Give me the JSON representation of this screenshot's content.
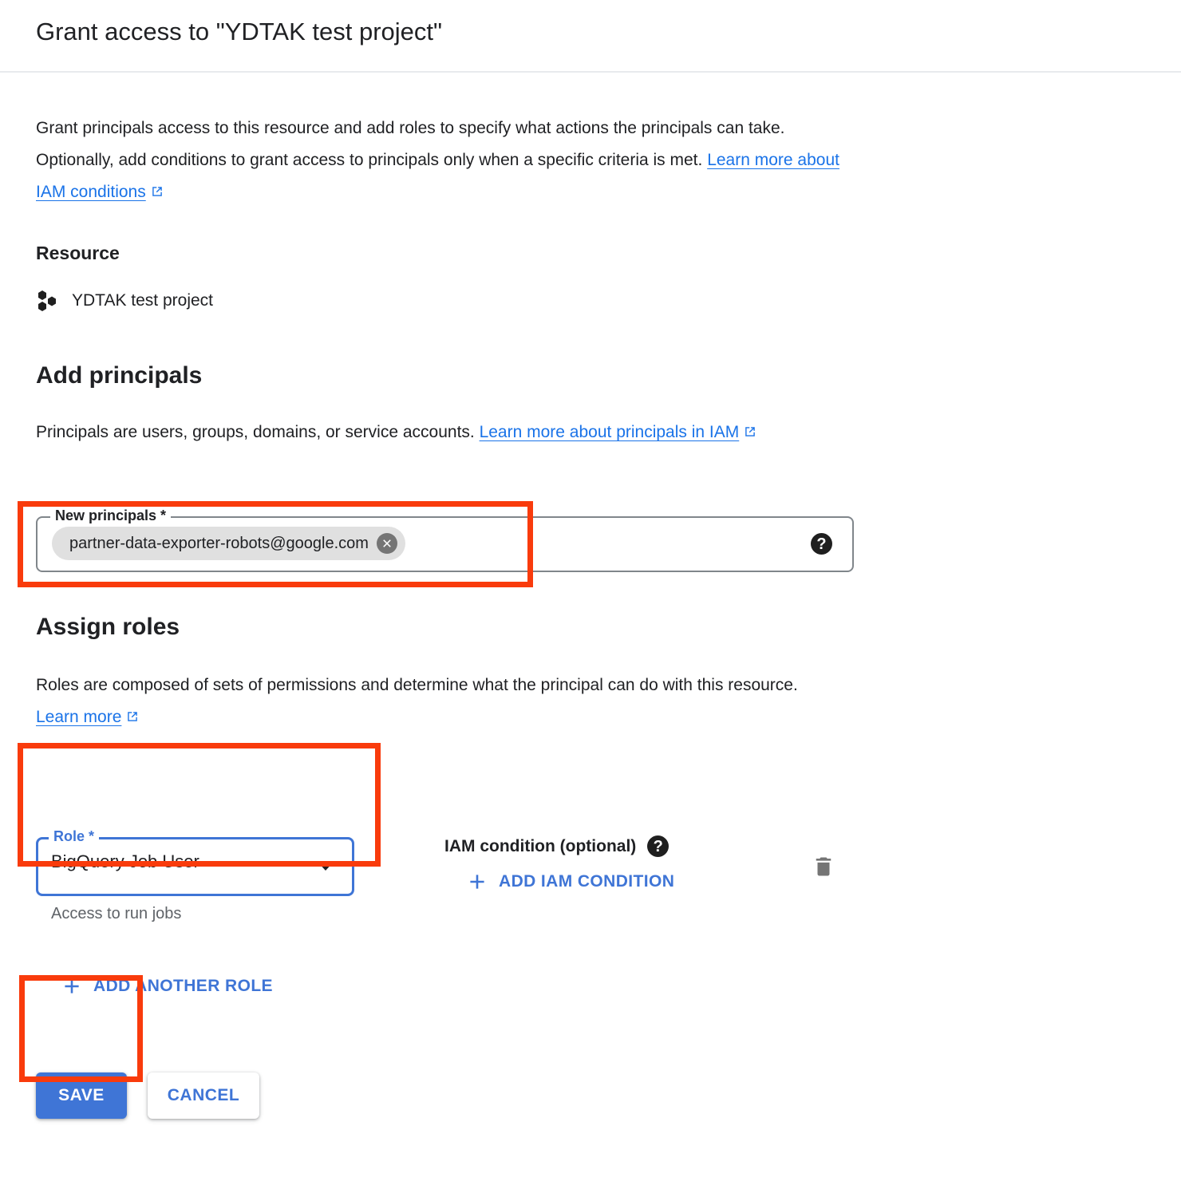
{
  "dialog": {
    "title": "Grant access to \"YDTAK test project\"",
    "intro_part1": "Grant principals access to this resource and add roles to specify what actions the principals can take. Optionally, add conditions to grant access to principals only when a specific criteria is met. ",
    "intro_link": "Learn more about IAM conditions"
  },
  "resource": {
    "heading": "Resource",
    "icon": "project-hexagons-icon",
    "name": "YDTAK test project"
  },
  "principals": {
    "heading": "Add principals",
    "description_part1": "Principals are users, groups, domains, or service accounts. ",
    "description_link": "Learn more about principals in IAM",
    "field_label": "New principals *",
    "chip_value": "partner-data-exporter-robots@google.com",
    "chip_remove_icon": "close-circle-icon",
    "help_icon": "help-icon",
    "help_glyph": "?"
  },
  "roles": {
    "heading": "Assign roles",
    "description_part1": "Roles are composed of sets of permissions and determine what the principal can do with this resource. ",
    "description_link": "Learn more",
    "role_label": "Role *",
    "role_value": "BigQuery Job User",
    "role_hint": "Access to run jobs",
    "iam_condition_label": "IAM condition (optional)",
    "iam_help_glyph": "?",
    "add_iam_condition": "ADD IAM CONDITION",
    "delete_icon": "trash-icon",
    "add_another_role": "ADD ANOTHER ROLE"
  },
  "actions": {
    "save": "SAVE",
    "cancel": "CANCEL"
  },
  "colors": {
    "accent_blue": "#3f75d6",
    "link_blue": "#1a73e8",
    "highlight_red": "#f93b0c",
    "text_primary": "#202124",
    "text_secondary": "#5f6368",
    "chip_bg": "#e0e0e0",
    "field_border": "#80868b"
  }
}
